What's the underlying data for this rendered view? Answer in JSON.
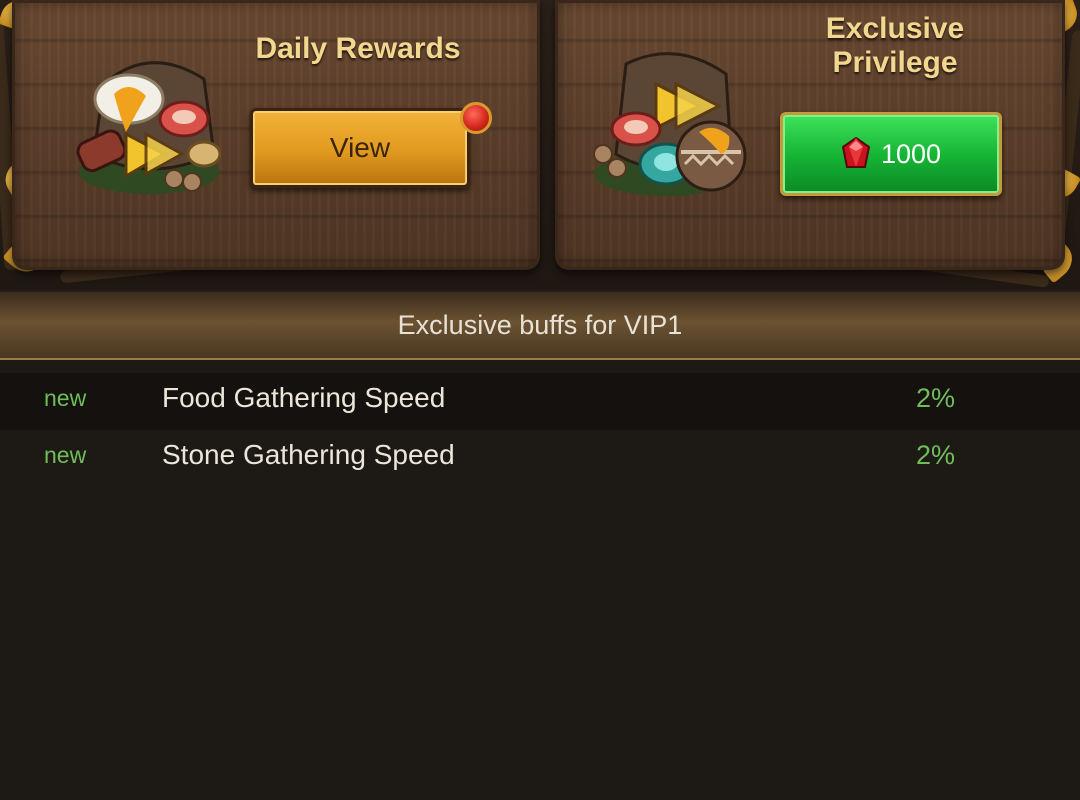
{
  "daily_rewards": {
    "title": "Daily Rewards",
    "button_label": "View",
    "has_notification": true
  },
  "exclusive_privilege": {
    "title_line1": "Exclusive",
    "title_line2": "Privilege",
    "price": "1000",
    "currency_icon": "ruby-gem-icon"
  },
  "vip_banner": {
    "text": "Exclusive buffs for VIP1"
  },
  "buffs": [
    {
      "tag": "new",
      "name": "Food Gathering Speed",
      "value": "2%"
    },
    {
      "tag": "new",
      "name": "Stone Gathering Speed",
      "value": "2%"
    }
  ],
  "colors": {
    "title_gold": "#f2d78e",
    "buff_green": "#6fbe5a",
    "button_orange": "#e09a1e",
    "button_green": "#17b637"
  }
}
